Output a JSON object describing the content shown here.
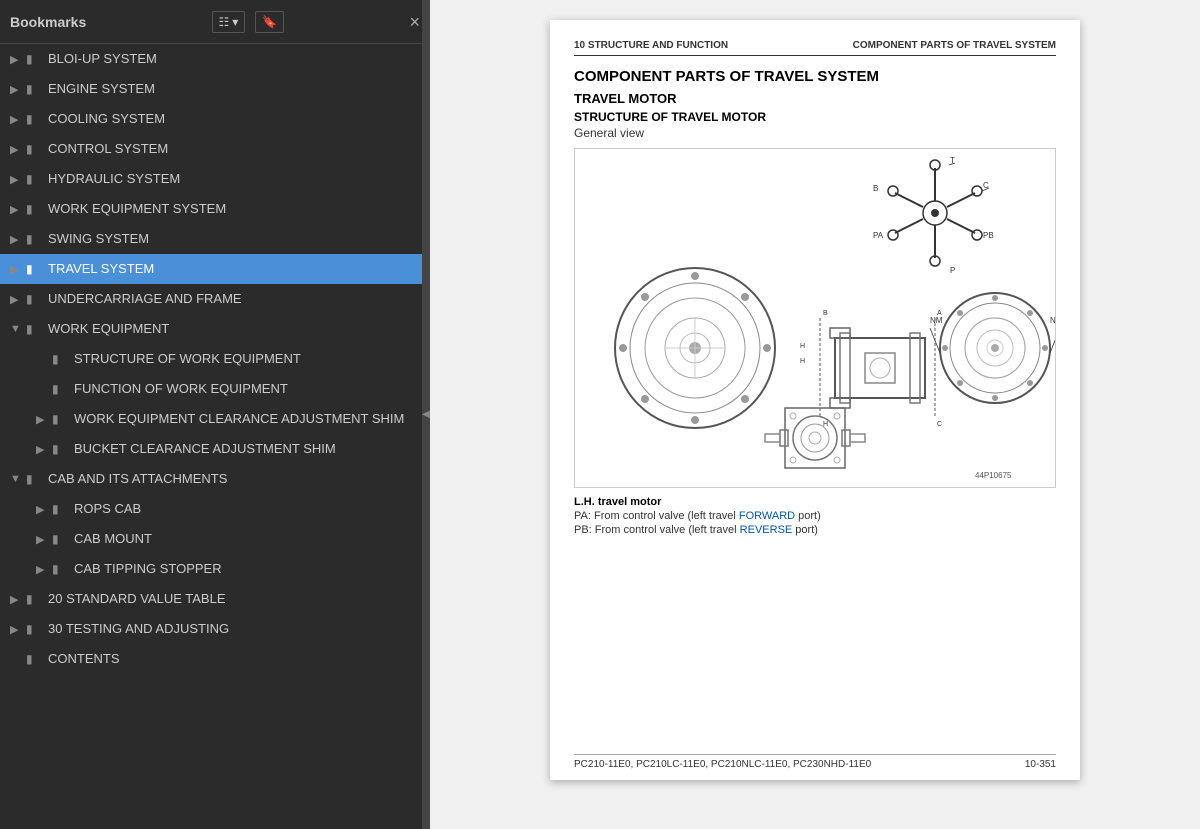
{
  "sidebar": {
    "title": "Bookmarks",
    "close_label": "×",
    "toolbar": {
      "view_btn": "☰▾",
      "search_btn": "🔖"
    },
    "items": [
      {
        "id": "blowup",
        "label": "BLOI-UP SYSTEM",
        "level": 0,
        "state": "collapsed",
        "active": false
      },
      {
        "id": "engine",
        "label": "ENGINE SYSTEM",
        "level": 0,
        "state": "collapsed",
        "active": false
      },
      {
        "id": "cooling",
        "label": "COOLING SYSTEM",
        "level": 0,
        "state": "collapsed",
        "active": false
      },
      {
        "id": "control",
        "label": "CONTROL SYSTEM",
        "level": 0,
        "state": "collapsed",
        "active": false
      },
      {
        "id": "hydraulic",
        "label": "HYDRAULIC SYSTEM",
        "level": 0,
        "state": "collapsed",
        "active": false
      },
      {
        "id": "work-equip-sys",
        "label": "WORK EQUIPMENT SYSTEM",
        "level": 0,
        "state": "collapsed",
        "active": false
      },
      {
        "id": "swing",
        "label": "SWING SYSTEM",
        "level": 0,
        "state": "collapsed",
        "active": false
      },
      {
        "id": "travel",
        "label": "TRAVEL SYSTEM",
        "level": 0,
        "state": "collapsed",
        "active": true
      },
      {
        "id": "undercarriage",
        "label": "UNDERCARRIAGE AND FRAME",
        "level": 0,
        "state": "collapsed",
        "active": false
      },
      {
        "id": "work-equip",
        "label": "WORK EQUIPMENT",
        "level": 0,
        "state": "expanded",
        "active": false
      },
      {
        "id": "struct-we",
        "label": "STRUCTURE OF WORK EQUIPMENT",
        "level": 1,
        "state": "leaf",
        "active": false
      },
      {
        "id": "func-we",
        "label": "FUNCTION OF WORK EQUIPMENT",
        "level": 1,
        "state": "leaf",
        "active": false
      },
      {
        "id": "we-clear-shim",
        "label": "WORK EQUIPMENT CLEARANCE ADJUSTMENT SHIM",
        "level": 1,
        "state": "collapsed",
        "active": false
      },
      {
        "id": "bucket-shim",
        "label": "BUCKET CLEARANCE ADJUSTMENT SHIM",
        "level": 1,
        "state": "collapsed",
        "active": false
      },
      {
        "id": "cab-attach",
        "label": "CAB AND ITS ATTACHMENTS",
        "level": 0,
        "state": "expanded",
        "active": false
      },
      {
        "id": "rops",
        "label": "ROPS CAB",
        "level": 1,
        "state": "collapsed",
        "active": false
      },
      {
        "id": "cab-mount",
        "label": "CAB MOUNT",
        "level": 1,
        "state": "collapsed",
        "active": false
      },
      {
        "id": "cab-stopper",
        "label": "CAB TIPPING STOPPER",
        "level": 1,
        "state": "collapsed",
        "active": false
      },
      {
        "id": "std-value",
        "label": "20 STANDARD VALUE TABLE",
        "level": 0,
        "state": "collapsed",
        "active": false
      },
      {
        "id": "testing",
        "label": "30 TESTING AND ADJUSTING",
        "level": 0,
        "state": "collapsed",
        "active": false
      },
      {
        "id": "contents",
        "label": "CONTENTS",
        "level": 0,
        "state": "leaf",
        "active": false
      }
    ]
  },
  "document": {
    "header_left": "10 STRUCTURE AND FUNCTION",
    "header_right": "COMPONENT PARTS OF TRAVEL SYSTEM",
    "title": "COMPONENT PARTS OF TRAVEL SYSTEM",
    "subtitle1": "TRAVEL MOTOR",
    "subtitle2": "STRUCTURE OF TRAVEL MOTOR",
    "general_view_label": "General view",
    "diagram_ref": "44P10675",
    "caption_title": "L.H. travel motor",
    "caption_pa": "PA: From control valve (left travel FORWARD port)",
    "caption_pb": "PB: From control valve (left travel REVERSE port)",
    "caption_pa_blue": "FORWARD",
    "caption_pb_blue": "REVERSE",
    "footer_left": "PC210-11E0, PC210LC-11E0, PC210NLC-11E0, PC230NHD-11E0",
    "footer_right": "10-351"
  }
}
